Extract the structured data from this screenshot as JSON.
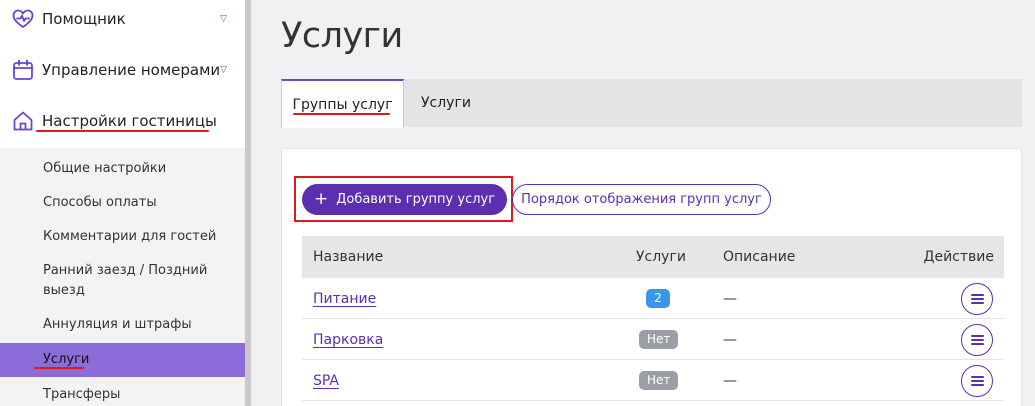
{
  "sidebar": {
    "items": [
      {
        "label": "Помощник",
        "icon": "heart-pulse-icon"
      },
      {
        "label": "Управление номерами",
        "icon": "calendar-icon"
      },
      {
        "label": "Настройки гостиницы",
        "icon": "home-icon"
      }
    ],
    "submenu": [
      {
        "label": "Общие настройки"
      },
      {
        "label": "Способы оплаты"
      },
      {
        "label": "Комментарии для гостей"
      },
      {
        "label": "Ранний заезд / Поздний выезд"
      },
      {
        "label": "Аннуляция и штрафы"
      },
      {
        "label": "Услуги"
      },
      {
        "label": "Трансферы"
      }
    ],
    "caret_glyph": "▽"
  },
  "page": {
    "title": "Услуги",
    "tabs": [
      {
        "label": "Группы услуг"
      },
      {
        "label": "Услуги"
      }
    ],
    "add_button": "Добавить группу услуг",
    "add_button_icon": "+",
    "order_button": "Порядок отображения групп услуг"
  },
  "table": {
    "headers": {
      "name": "Название",
      "services": "Услуги",
      "description": "Описание",
      "action": "Действие"
    },
    "rows": [
      {
        "name": "Питание",
        "services": "2",
        "services_type": "count",
        "description": "—"
      },
      {
        "name": "Парковка",
        "services": "Нет",
        "services_type": "none",
        "description": "—"
      },
      {
        "name": "SPA",
        "services": "Нет",
        "services_type": "none",
        "description": "—"
      }
    ]
  },
  "colors": {
    "accent": "#5b2fb0",
    "active_submenu": "#8c6cd8",
    "highlight": "#e0191e",
    "badge_count": "#3a96e6",
    "badge_none": "#9a9ea6"
  }
}
